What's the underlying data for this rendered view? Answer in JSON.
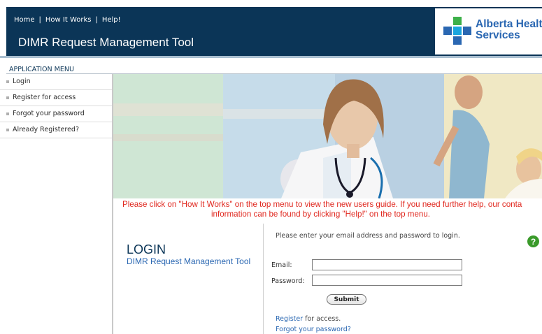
{
  "header": {
    "nav": {
      "home": "Home",
      "how_it_works": "How It Works",
      "help": "Help!",
      "separator": "|"
    },
    "app_title": "DIMR Request Management Tool",
    "logo": {
      "line1": "Alberta Health",
      "line2": "Services"
    }
  },
  "sidebar": {
    "title": "APPLICATION MENU",
    "items": [
      {
        "label": "Login"
      },
      {
        "label": "Register for access"
      },
      {
        "label": "Forgot your password"
      },
      {
        "label": "Already Registered?"
      }
    ]
  },
  "notice": {
    "line1": "Please click on \"How It Works\" on the top menu to view the new users guide. If you need further help, our conta",
    "line2": "information can be found by clicking \"Help!\" on the top menu."
  },
  "login": {
    "heading": "LOGIN",
    "subheading": "DIMR Request Management Tool",
    "instructions": "Please enter your email address and password to login.",
    "email_label": "Email:",
    "password_label": "Password:",
    "email_value": "",
    "password_value": "",
    "submit_label": "Submit",
    "register_link": "Register",
    "register_suffix": " for access.",
    "forgot_link": "Forgot your password?"
  },
  "colors": {
    "header_bg": "#0b3557",
    "brand_blue": "#2a67b2",
    "brand_green": "#1aa6df",
    "notice_red": "#e0281f",
    "help_green": "#3a9a2a"
  },
  "icons": {
    "help": "help-icon",
    "menu_bullet": "square-bullet"
  }
}
